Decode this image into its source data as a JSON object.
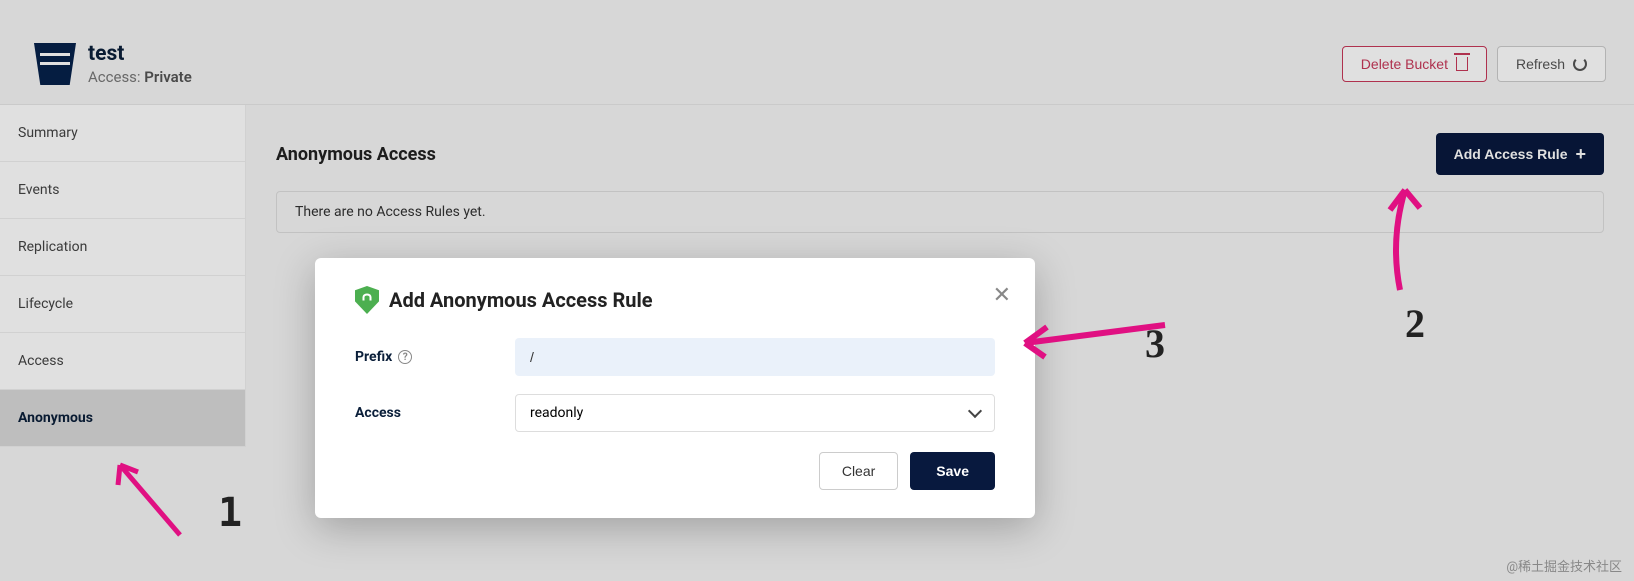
{
  "header": {
    "bucket_name": "test",
    "access_label": "Access:",
    "access_value": "Private",
    "delete_button": "Delete Bucket",
    "refresh_button": "Refresh"
  },
  "sidebar": {
    "items": [
      {
        "label": "Summary"
      },
      {
        "label": "Events"
      },
      {
        "label": "Replication"
      },
      {
        "label": "Lifecycle"
      },
      {
        "label": "Access"
      },
      {
        "label": "Anonymous"
      }
    ]
  },
  "main": {
    "title": "Anonymous Access",
    "add_rule_button": "Add Access Rule",
    "empty_text": "There are no Access Rules yet."
  },
  "modal": {
    "title": "Add Anonymous Access Rule",
    "prefix_label": "Prefix",
    "prefix_value": "/",
    "access_label": "Access",
    "access_value": "readonly",
    "clear_button": "Clear",
    "save_button": "Save"
  },
  "annotations": {
    "n1": "1",
    "n2": "2",
    "n3": "3"
  },
  "watermark": "@稀土掘金技术社区"
}
